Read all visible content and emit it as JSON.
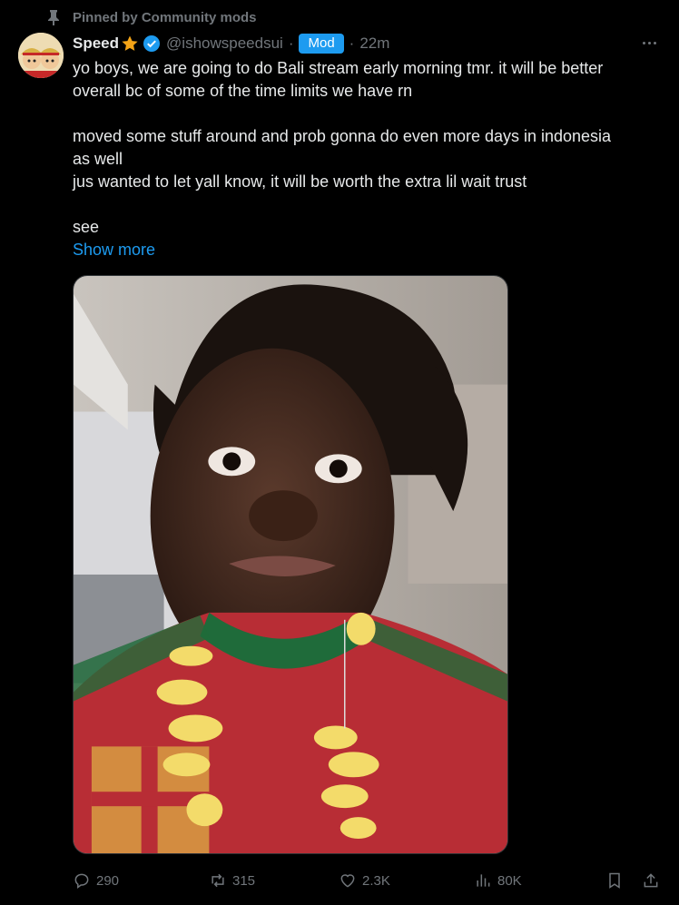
{
  "pinned_label": "Pinned by Community mods",
  "author": {
    "name": "Speed",
    "handle": "@ishowspeedsui",
    "badge": "Mod",
    "time": "22m"
  },
  "post": {
    "line1": "yo boys, we are going to do Bali stream early morning tmr. it will be better",
    "line2": "overall bc of some of the time limits we have rn",
    "line3": "moved some stuff around and prob gonna do even more days in indonesia",
    "line4": "as well",
    "line5": "jus wanted to let yall know, it will be worth the extra lil wait trust",
    "line6": "see",
    "show_more": "Show more"
  },
  "stats": {
    "replies": "290",
    "reposts": "315",
    "likes": "2.3K",
    "views": "80K"
  },
  "colors": {
    "accent": "#1d9bf0",
    "muted": "#71767b",
    "text": "#e7e9ea",
    "star": "#f4a417"
  }
}
